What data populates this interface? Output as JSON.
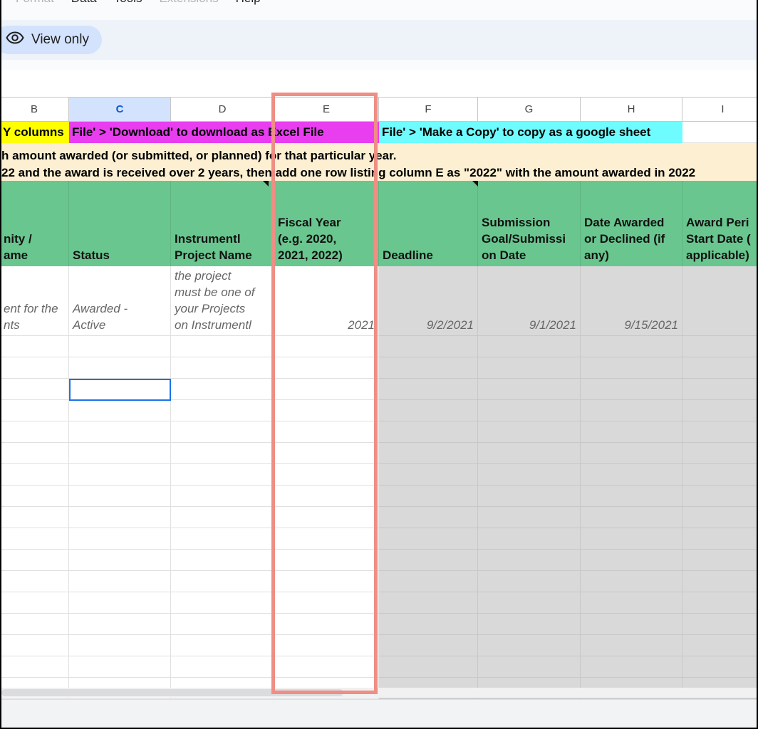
{
  "menu": [
    "Format",
    "Data",
    "Tools",
    "Extensions",
    "Help"
  ],
  "toolbar": {
    "view_only": "View only",
    "icon": "eye-icon"
  },
  "columns": [
    {
      "label": "B"
    },
    {
      "label": "C",
      "selected": true
    },
    {
      "label": "D"
    },
    {
      "label": "E"
    },
    {
      "label": "F"
    },
    {
      "label": "G"
    },
    {
      "label": "H"
    },
    {
      "label": "I"
    }
  ],
  "banners": [
    {
      "text": "Y columns",
      "color": "#ffff00"
    },
    {
      "text": "File' > 'Download' to download as Excel File",
      "color": "#e93df0"
    },
    {
      "text": "File' > 'Make a Copy' to copy as a google sheet",
      "color": "#6ffcff"
    }
  ],
  "notes": [
    "h amount awarded (or submitted, or planned) for that particular year.",
    "22 and the award is received over 2 years, then add one row listing column E as \"2022\" with the amount awarded in 2022"
  ],
  "headers": [
    "nity /\name",
    "Status",
    "Instrumentl\nProject Name",
    "Fiscal Year\n(e.g. 2020,\n2021, 2022)",
    "Deadline",
    "Submission\nGoal/Submissi\non Date",
    "Date Awarded\nor Declined (if\nany)",
    "Award Peri\nStart Date (\napplicable)"
  ],
  "example_row": [
    "ent for the\nnts",
    "Awarded -\nActive",
    "the project\nmust be one of\nyour Projects\non Instrumentl",
    "2021",
    "9/2/2021",
    "9/1/2021",
    "9/15/2021",
    ""
  ],
  "colors": {
    "header_green": "#6ac68f",
    "note_bg": "#fdf0d2",
    "highlight": "#ee8e84",
    "gray_fill": "#d9d9d9"
  }
}
